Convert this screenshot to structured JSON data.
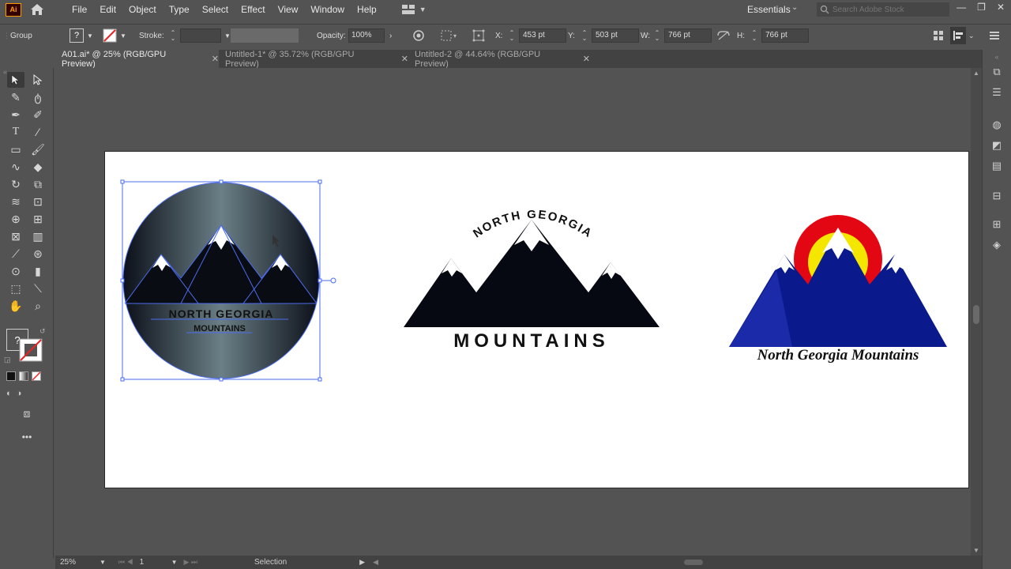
{
  "app": {
    "logo_label": "Ai"
  },
  "menu": [
    "File",
    "Edit",
    "Object",
    "Type",
    "Select",
    "Effect",
    "View",
    "Window",
    "Help"
  ],
  "workspace": {
    "label": "Essentials",
    "search_placeholder": "Search Adobe Stock"
  },
  "control_bar": {
    "selection_label": "Group",
    "stroke_label": "Stroke:",
    "opacity_label": "Opacity:",
    "opacity_value": "100%",
    "x_label": "X:",
    "x_value": "453 pt",
    "y_label": "Y:",
    "y_value": "503 pt",
    "w_label": "W:",
    "w_value": "766 pt",
    "h_label": "H:",
    "h_value": "766 pt"
  },
  "tabs": [
    {
      "label": "A01.ai* @ 25% (RGB/GPU Preview)",
      "active": true
    },
    {
      "label": "Untitled-1* @ 35.72% (RGB/GPU Preview)",
      "active": false
    },
    {
      "label": "Untitled-2 @ 44.64% (RGB/GPU Preview)",
      "active": false
    }
  ],
  "artwork": {
    "logo1": {
      "line1": "NORTH GEORGIA",
      "line2": "MOUNTAINS"
    },
    "logo2": {
      "arc_text": "NORTH GEORGIA",
      "bottom_text": "MOUNTAINS"
    },
    "logo3": {
      "text": "North Georgia Mountains"
    }
  },
  "status": {
    "zoom": "25%",
    "page": "1",
    "tool": "Selection"
  },
  "colors": {
    "accent_selection": "#4a6cf0",
    "logo3_blue": "#0a1a8c",
    "logo3_red": "#e30613",
    "logo3_yellow": "#f5e600"
  }
}
